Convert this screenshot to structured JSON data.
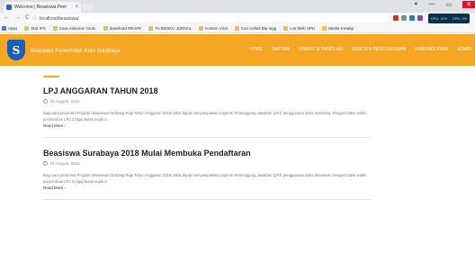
{
  "browser": {
    "tab_title": "Welcome | Beasiswa Pem",
    "tab_close": "×",
    "window_buttons": {
      "user": "●",
      "minimize": "—",
      "maximize": "▭",
      "close": "✕"
    },
    "nav": {
      "back": "←",
      "forward": "→",
      "reload": "C"
    },
    "url_info": "ⓘ",
    "url": "localhost/beasiswa/",
    "perf_cpu": "CPU: 11%",
    "perf_net": "CPU: 2%",
    "bookmarks": [
      "Apps",
      "Stat IPS",
      "Cara Adsense Youtu",
      "download REAPK",
      "TA BOSKU JURNAL",
      "Konten Viral",
      "Cari Artikel Bla Ingg",
      "List Web HPK",
      "Media Kreatip"
    ]
  },
  "site": {
    "logo_text": "S",
    "title": "Beasiswa Pemerintah Kota Surabaya",
    "nav": [
      "HOME",
      "DAFTAR",
      "SYARAT & PANDUAN",
      "BERITA & PENGUMUMAN",
      "HUBUNGI KAMI",
      "ADMIN"
    ]
  },
  "posts": [
    {
      "title": "LPJ ANGGARAN TAHUN 2018",
      "date": "01 August, 2018",
      "excerpt": "Bagi para penerima Program Beasiswa Gerbang Raja Tahun Anggaran 2018 untuk dapat menyampaikan Laporan Pertanggung Jawaban (LPJ) penggunaan dana beasiswa. Dengan batas waktu penyerahan LPJ 3 (tiga) bulan sejak d",
      "read_more": "Read More ›"
    },
    {
      "title": "Beasiswa Surabaya 2018 Mulai Membuka Pendaftaran",
      "date": "01 August, 2018",
      "excerpt": "Bagi para penerima Program Beasiswa Gerbang Raja Tahun Anggaran 2018 untuk dapat menyampaikan Laporan Pertanggung Jawaban (LPJ) penggunaan dana beasiswa. Dengan batas waktu penyerahan LPJ 3 (tiga) bulan sejak d",
      "read_more": "Read More ›"
    }
  ]
}
